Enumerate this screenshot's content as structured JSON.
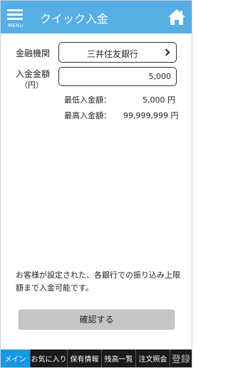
{
  "header": {
    "menu_label": "MENU",
    "title": "クイック入金"
  },
  "form": {
    "bank_label": "金融機関",
    "bank_value": "三井住友銀行",
    "amount_label_line1": "入金金額",
    "amount_label_line2": "（円）",
    "amount_value": "5,000",
    "min_label": "最低入金額：",
    "min_value": "5,000 円",
    "max_label": "最高入金額：",
    "max_value": "99,999,999 円"
  },
  "note": "お客様が設定された、各銀行での振り込み上限額まで入金可能です。",
  "confirm_label": "確認する",
  "tabs": [
    {
      "label": "メイン",
      "active": true
    },
    {
      "label": "お気に入り",
      "active": false
    },
    {
      "label": "保有情報",
      "active": false
    },
    {
      "label": "残高一覧",
      "active": false
    },
    {
      "label": "注文照会",
      "active": false
    },
    {
      "label": "登録",
      "active": false
    }
  ],
  "colors": {
    "header": "#56aee5",
    "tab_active": "#1598e4",
    "tabbar": "#1a1a1a",
    "button": "#c6c6c6"
  }
}
